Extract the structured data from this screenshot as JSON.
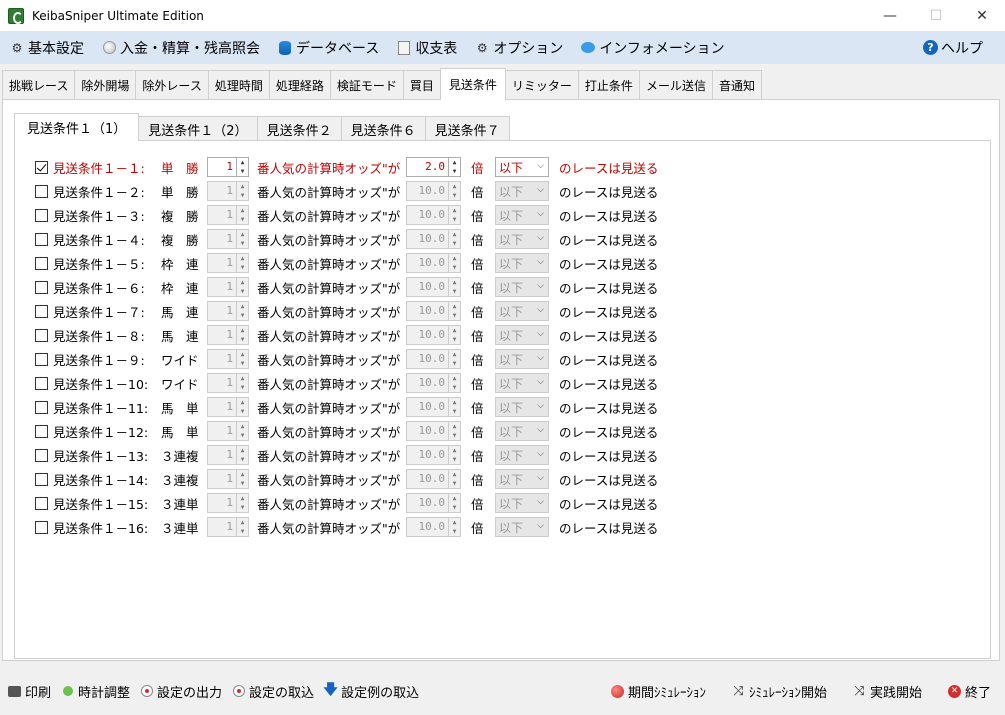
{
  "window": {
    "title": "KeibaSniper Ultimate Edition",
    "controls": {
      "minimize": "—",
      "maximize": "☐",
      "close": "✕"
    }
  },
  "menu": {
    "items": [
      {
        "label": "基本設定",
        "icon": "gear-icon"
      },
      {
        "label": "入金・精算・残高照会",
        "icon": "coin-icon"
      },
      {
        "label": "データベース",
        "icon": "database-icon"
      },
      {
        "label": "収支表",
        "icon": "ledger-icon"
      },
      {
        "label": "オプション",
        "icon": "gear-icon"
      },
      {
        "label": "インフォメーション",
        "icon": "chat-bubble-icon"
      }
    ],
    "help": {
      "label": "ヘルプ",
      "icon": "help-icon"
    }
  },
  "main_tabs": [
    "挑戦レース",
    "除外開場",
    "除外レース",
    "処理時間",
    "処理経路",
    "検証モード",
    "買目",
    "見送条件",
    "リミッター",
    "打止条件",
    "メール送信",
    "音通知"
  ],
  "main_tab_active": "見送条件",
  "sub_tabs": [
    "見送条件１（1）",
    "見送条件１（2）",
    "見送条件２",
    "見送条件６",
    "見送条件７"
  ],
  "sub_tab_active": "見送条件１（1）",
  "common": {
    "popularity_text": "番人気の計算時オッズ\"が",
    "bai": "倍",
    "skip_text": "のレースは見送る",
    "spin_up": "▲",
    "spin_down": "▼",
    "chevron": "⌵"
  },
  "conditions": [
    {
      "label": "見送条件１－１:",
      "type": "単　勝",
      "rank": "1",
      "odds": "2.0",
      "compare": "以下",
      "checked": true
    },
    {
      "label": "見送条件１－２:",
      "type": "単　勝",
      "rank": "1",
      "odds": "10.0",
      "compare": "以下",
      "checked": false
    },
    {
      "label": "見送条件１－３:",
      "type": "複　勝",
      "rank": "1",
      "odds": "10.0",
      "compare": "以下",
      "checked": false
    },
    {
      "label": "見送条件１－４:",
      "type": "複　勝",
      "rank": "1",
      "odds": "10.0",
      "compare": "以下",
      "checked": false
    },
    {
      "label": "見送条件１－５:",
      "type": "枠　連",
      "rank": "1",
      "odds": "10.0",
      "compare": "以下",
      "checked": false
    },
    {
      "label": "見送条件１－６:",
      "type": "枠　連",
      "rank": "1",
      "odds": "10.0",
      "compare": "以下",
      "checked": false
    },
    {
      "label": "見送条件１－７:",
      "type": "馬　連",
      "rank": "1",
      "odds": "10.0",
      "compare": "以下",
      "checked": false
    },
    {
      "label": "見送条件１－８:",
      "type": "馬　連",
      "rank": "1",
      "odds": "10.0",
      "compare": "以下",
      "checked": false
    },
    {
      "label": "見送条件１－９:",
      "type": "ワイド",
      "rank": "1",
      "odds": "10.0",
      "compare": "以下",
      "checked": false
    },
    {
      "label": "見送条件１－10:",
      "type": "ワイド",
      "rank": "1",
      "odds": "10.0",
      "compare": "以下",
      "checked": false
    },
    {
      "label": "見送条件１－11:",
      "type": "馬　単",
      "rank": "1",
      "odds": "10.0",
      "compare": "以下",
      "checked": false
    },
    {
      "label": "見送条件１－12:",
      "type": "馬　単",
      "rank": "1",
      "odds": "10.0",
      "compare": "以下",
      "checked": false
    },
    {
      "label": "見送条件１－13:",
      "type": "３連複",
      "rank": "1",
      "odds": "10.0",
      "compare": "以下",
      "checked": false
    },
    {
      "label": "見送条件１－14:",
      "type": "３連複",
      "rank": "1",
      "odds": "10.0",
      "compare": "以下",
      "checked": false
    },
    {
      "label": "見送条件１－15:",
      "type": "３連単",
      "rank": "1",
      "odds": "10.0",
      "compare": "以下",
      "checked": false
    },
    {
      "label": "見送条件１－16:",
      "type": "３連単",
      "rank": "1",
      "odds": "10.0",
      "compare": "以下",
      "checked": false
    }
  ],
  "bottom_left": [
    {
      "label": "印刷",
      "icon": "printer-icon"
    },
    {
      "label": "時計調整",
      "icon": "green-dot-icon"
    },
    {
      "label": "設定の出力",
      "icon": "radio-dot-icon"
    },
    {
      "label": "設定の取込",
      "icon": "radio-dot-icon"
    },
    {
      "label": "設定例の取込",
      "icon": "down-arrow-icon"
    }
  ],
  "bottom_right": [
    {
      "label": "期間ｼﾐｭﾚｰｼｮﾝ",
      "icon": "red-ball-icon"
    },
    {
      "label": "ｼﾐｭﾚｰｼｮﾝ開始",
      "icon": "shuffle-icon"
    },
    {
      "label": "実践開始",
      "icon": "shuffle-icon"
    },
    {
      "label": "終了",
      "icon": "stop-icon"
    }
  ],
  "colors": {
    "menu_bg": "#dbe6f4",
    "active_condition_text": "#c00000"
  }
}
